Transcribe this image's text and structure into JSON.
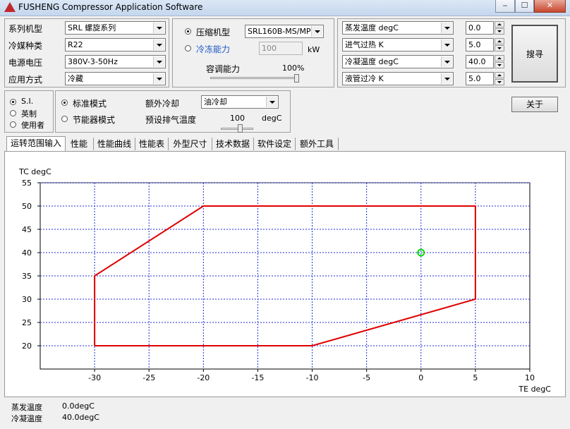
{
  "window": {
    "title": "FUSHENG Compressor Application Software",
    "min": "‒",
    "max": "☐",
    "close": "✕"
  },
  "left_panel": {
    "rows": [
      {
        "label": "系列机型",
        "value": "SRL 螺旋系列"
      },
      {
        "label": "冷媒种类",
        "value": "R22"
      },
      {
        "label": "电源电压",
        "value": "380V-3-50Hz"
      },
      {
        "label": "应用方式",
        "value": "冷藏"
      }
    ]
  },
  "mid_panel": {
    "compressor_label": "压缩机型",
    "compressor_value": "SRL160B-MS/MP",
    "capacity_label": "冷冻能力",
    "capacity_value": "100",
    "capacity_unit": "kW",
    "regulation_label": "容调能力",
    "regulation_value": "100%",
    "regulation_fraction": 1.0
  },
  "right_panel": {
    "rows": [
      {
        "label": "蒸发温度 degC",
        "value": "0.0"
      },
      {
        "label": "进气过热 K",
        "value": "5.0"
      },
      {
        "label": "冷凝温度 degC",
        "value": "40.0"
      },
      {
        "label": "液管过冷 K",
        "value": "5.0"
      }
    ],
    "search_label": "搜寻"
  },
  "units": {
    "options": [
      "S.I.",
      "英制",
      "使用者"
    ],
    "selected": 0
  },
  "mode_panel": {
    "standard_label": "标准模式",
    "economizer_label": "节能器模式",
    "extra_cooling_label": "额外冷却",
    "extra_cooling_value": "油冷却",
    "discharge_label": "预设排气温度",
    "discharge_value": "100",
    "discharge_unit": "degC"
  },
  "about_label": "关于",
  "tabs": [
    "运转范围输入",
    "性能",
    "性能曲线",
    "性能表",
    "外型尺寸",
    "技术数据",
    "软件设定",
    "额外工具"
  ],
  "active_tab": 0,
  "chart_data": {
    "type": "line",
    "xlabel": "TE degC",
    "ylabel": "TC degC",
    "xlim": [
      -35,
      10
    ],
    "ylim": [
      15,
      55
    ],
    "xticks": [
      -30,
      -25,
      -20,
      -15,
      -10,
      -5,
      0,
      5,
      10
    ],
    "yticks": [
      20,
      25,
      30,
      35,
      40,
      45,
      50,
      55
    ],
    "grid": true,
    "envelope": {
      "x": [
        -30,
        -30,
        -10,
        5,
        5,
        -20,
        -30
      ],
      "y": [
        20,
        35,
        20,
        30,
        50,
        50,
        35
      ],
      "color": "#e00000"
    },
    "envelope_path": [
      [
        -30,
        20
      ],
      [
        -10,
        20
      ],
      [
        5,
        30
      ],
      [
        5,
        50
      ],
      [
        -20,
        50
      ],
      [
        -30,
        35
      ],
      [
        -30,
        20
      ]
    ],
    "operating_point": {
      "x": 0,
      "y": 40,
      "color": "#00e000"
    }
  },
  "status": [
    {
      "label": "蒸发温度",
      "value": "0.0degC"
    },
    {
      "label": "冷凝温度",
      "value": "40.0degC"
    }
  ]
}
